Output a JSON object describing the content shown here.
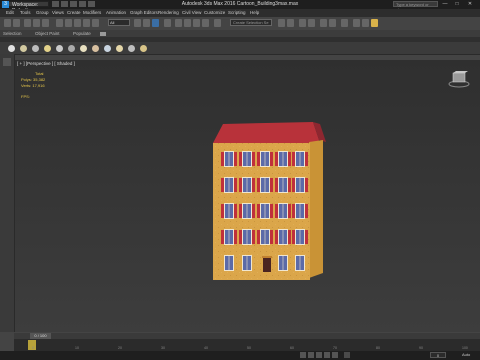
{
  "window": {
    "workspace": "Workspace: Default",
    "title": "Autodesk 3ds Max 2016     Cartoon_Building3max.max",
    "search_placeholder": "Type a keyword or phrase",
    "controls": [
      "—",
      "□",
      "✕"
    ]
  },
  "menu": [
    "Edit",
    "Tools",
    "Group",
    "Views",
    "Create",
    "Modifiers",
    "Animation",
    "Graph Editors",
    "Rendering",
    "Civil View",
    "Customize",
    "Scripting",
    "Help"
  ],
  "toolbar": {
    "filter": "All",
    "selection_set": "Create Selection Se"
  },
  "ribbon_tabs": [
    "Selection",
    "Object Paint",
    "Populate"
  ],
  "viewport": {
    "label": "[ + ] [Perspective ] [ Shaded ]",
    "stats": {
      "total": "Total",
      "polys_label": "Polys:",
      "polys": "35,382",
      "verts_label": "Verts:",
      "verts": "17,916"
    },
    "fps": "FPS:"
  },
  "timeline": {
    "frame": "0 / 100",
    "ticks": [
      "0",
      "10",
      "20",
      "30",
      "40",
      "50",
      "60",
      "70",
      "80",
      "90",
      "100"
    ]
  },
  "status": {
    "left": "",
    "right": "Auto"
  },
  "colors": {
    "roof": "#b8323a",
    "wall": "#dba64a",
    "shutter": "#c0303a",
    "window": "#5b6aa8"
  }
}
